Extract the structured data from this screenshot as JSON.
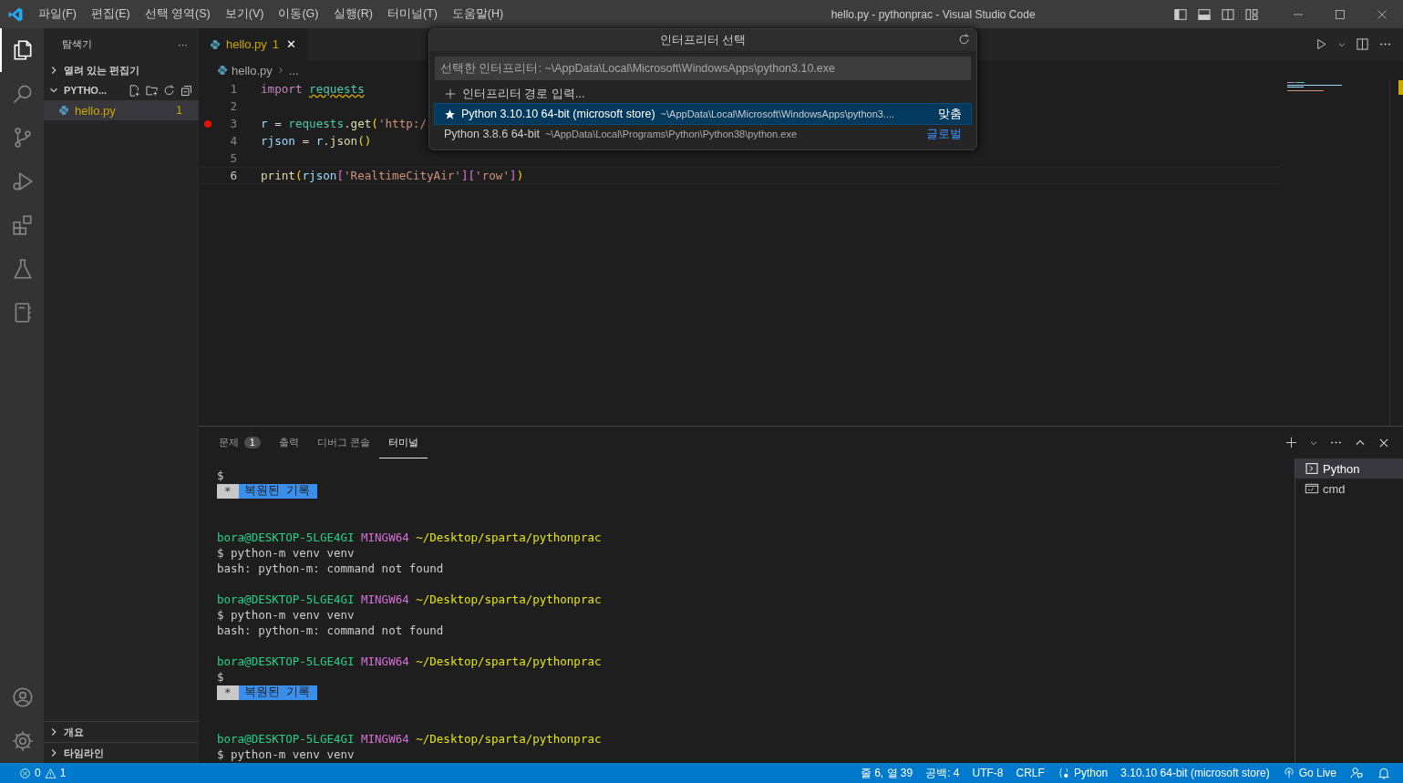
{
  "window": {
    "title": "hello.py - pythonprac - Visual Studio Code"
  },
  "menu": [
    "파일(F)",
    "편집(E)",
    "선택 영역(S)",
    "보기(V)",
    "이동(G)",
    "실행(R)",
    "터미널(T)",
    "도움말(H)"
  ],
  "activity_bar": [
    {
      "kind": "files",
      "selected": true
    },
    {
      "kind": "search",
      "selected": false
    },
    {
      "kind": "branch",
      "selected": false
    },
    {
      "kind": "run",
      "selected": false
    },
    {
      "kind": "extensions",
      "selected": false
    },
    {
      "kind": "flask",
      "selected": false
    },
    {
      "kind": "notebook",
      "selected": false
    }
  ],
  "activity_bar_bottom": [
    {
      "kind": "account"
    },
    {
      "kind": "gear"
    }
  ],
  "sidebar": {
    "title": "탐색기",
    "more": "···",
    "sections": [
      {
        "label": "열려 있는 편집기",
        "expanded": false
      },
      {
        "label": "PYTHO...",
        "expanded": true,
        "files": [
          {
            "name": "hello.py",
            "badge": "1",
            "selected": true
          }
        ]
      }
    ],
    "bottom_sections": [
      {
        "label": "개요",
        "expanded": false
      },
      {
        "label": "타임라인",
        "expanded": false
      }
    ]
  },
  "editor": {
    "tab": {
      "name": "hello.py",
      "badge": "1",
      "close": "✕"
    },
    "breadcrumb": [
      "hello.py",
      "..."
    ],
    "lines": [
      {
        "number": "1",
        "active": false,
        "tokens": [
          {
            "kind": "kw",
            "text": "import "
          },
          {
            "kind": "mod",
            "text": "requests",
            "warning": true
          }
        ]
      },
      {
        "number": "2",
        "active": false
      },
      {
        "number": "3",
        "breakpoint": true,
        "active": false,
        "tokens": [
          {
            "kind": "var",
            "text": "r"
          },
          {
            "kind": "op",
            "text": " = "
          },
          {
            "kind": "mod",
            "text": "requests"
          },
          {
            "kind": "op",
            "text": "."
          },
          {
            "kind": "fn",
            "text": "get"
          },
          {
            "kind": "p1",
            "text": "("
          },
          {
            "kind": "str",
            "text": "'http:/"
          }
        ]
      },
      {
        "number": "4",
        "active": false,
        "tokens": [
          {
            "kind": "var",
            "text": "rjson"
          },
          {
            "kind": "op",
            "text": " = "
          },
          {
            "kind": "var",
            "text": "r"
          },
          {
            "kind": "op",
            "text": "."
          },
          {
            "kind": "fn",
            "text": "json"
          },
          {
            "kind": "p1",
            "text": "()"
          }
        ]
      },
      {
        "number": "5",
        "active": false
      },
      {
        "number": "6",
        "active": true,
        "tokens": [
          {
            "kind": "fn",
            "text": "print"
          },
          {
            "kind": "p1",
            "text": "("
          },
          {
            "kind": "var",
            "text": "rjson"
          },
          {
            "kind": "p2",
            "text": "["
          },
          {
            "kind": "str",
            "text": "'RealtimeCityAir'"
          },
          {
            "kind": "p2",
            "text": "]["
          },
          {
            "kind": "str",
            "text": "'row'"
          },
          {
            "kind": "p2",
            "text": "]"
          },
          {
            "kind": "p1",
            "text": ")"
          }
        ]
      }
    ]
  },
  "quick_pick": {
    "title": "인터프리터 선택",
    "placeholder": "선택한 인터프리터: ~\\AppData\\Local\\Microsoft\\WindowsApps\\python3.10.exe",
    "items": [
      {
        "kind": "action",
        "label": "인터프리터 경로 입력...",
        "selected": false
      },
      {
        "kind": "interpreter",
        "label": "Python 3.10.10 64-bit (microsoft store)",
        "description": "~\\AppData\\Local\\Microsoft\\WindowsApps\\python3....",
        "tag": "맞춤",
        "starred": true,
        "selected": true
      },
      {
        "kind": "interpreter",
        "label": "Python 3.8.6 64-bit",
        "description": "~\\AppData\\Local\\Programs\\Python\\Python38\\python.exe",
        "tag": "글로벌",
        "starred": false,
        "selected": false
      }
    ]
  },
  "panel": {
    "tabs": [
      {
        "label": "문제",
        "badge": "1",
        "selected": false
      },
      {
        "label": "출력",
        "selected": false
      },
      {
        "label": "디버그 콘솔",
        "selected": false
      },
      {
        "label": "터미널",
        "selected": true
      }
    ],
    "terminal": [
      {
        "kind": "text",
        "text": "$"
      },
      {
        "kind": "restored",
        "mark": "*",
        "text": "복원된 기록"
      },
      {
        "kind": "blank"
      },
      {
        "kind": "blank"
      },
      {
        "kind": "prompt",
        "user": "bora@DESKTOP-5LGE4GI",
        "host": "MINGW64",
        "path": "~/Desktop/sparta/pythonprac"
      },
      {
        "kind": "text",
        "text": "$ python-m venv venv"
      },
      {
        "kind": "text",
        "text": "bash: python-m: command not found"
      },
      {
        "kind": "blank"
      },
      {
        "kind": "prompt",
        "user": "bora@DESKTOP-5LGE4GI",
        "host": "MINGW64",
        "path": "~/Desktop/sparta/pythonprac"
      },
      {
        "kind": "text",
        "text": "$ python-m venv venv"
      },
      {
        "kind": "text",
        "text": "bash: python-m: command not found"
      },
      {
        "kind": "blank"
      },
      {
        "kind": "prompt",
        "user": "bora@DESKTOP-5LGE4GI",
        "host": "MINGW64",
        "path": "~/Desktop/sparta/pythonprac"
      },
      {
        "kind": "text",
        "text": "$"
      },
      {
        "kind": "restored",
        "mark": "*",
        "text": "복원된 기록"
      },
      {
        "kind": "blank"
      },
      {
        "kind": "blank"
      },
      {
        "kind": "prompt",
        "user": "bora@DESKTOP-5LGE4GI",
        "host": "MINGW64",
        "path": "~/Desktop/sparta/pythonprac"
      },
      {
        "kind": "text",
        "text": "$ python-m venv venv"
      }
    ],
    "terminals": [
      {
        "kind": "shell",
        "label": "Python",
        "selected": true
      },
      {
        "kind": "cmd",
        "label": "cmd",
        "selected": false
      }
    ]
  },
  "status_bar": {
    "errors": "0",
    "warnings": "1",
    "items": [
      {
        "kind": "text",
        "text": "줄 6, 열 39"
      },
      {
        "kind": "text",
        "text": "공백: 4"
      },
      {
        "kind": "text",
        "text": "UTF-8"
      },
      {
        "kind": "text",
        "text": "CRLF"
      },
      {
        "kind": "braces",
        "text": "Python"
      },
      {
        "kind": "text",
        "text": "3.10.10 64-bit (microsoft store)"
      },
      {
        "kind": "broadcast",
        "text": "Go Live"
      },
      {
        "kind": "feedback"
      },
      {
        "kind": "bell"
      }
    ]
  }
}
